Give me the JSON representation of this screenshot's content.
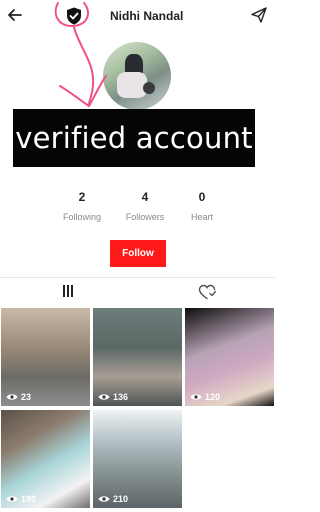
{
  "header": {
    "title": "Nidhi Nandal",
    "back_icon": "arrow-left-icon",
    "verified_icon": "verified-shield-icon",
    "share_icon": "send-icon"
  },
  "annotation": {
    "text": "verified account",
    "color": "#f0508c"
  },
  "stats": [
    {
      "value": "2",
      "label": "Following"
    },
    {
      "value": "4",
      "label": "Followers"
    },
    {
      "value": "0",
      "label": "Heart"
    }
  ],
  "follow_button": {
    "label": "Follow",
    "color": "#ff1a1a"
  },
  "tabs": [
    {
      "icon": "grid-icon"
    },
    {
      "icon": "liked-heart-icon"
    }
  ],
  "videos": [
    {
      "views": "23"
    },
    {
      "views": "136"
    },
    {
      "views": "120"
    },
    {
      "views": "190"
    },
    {
      "views": "210"
    }
  ]
}
